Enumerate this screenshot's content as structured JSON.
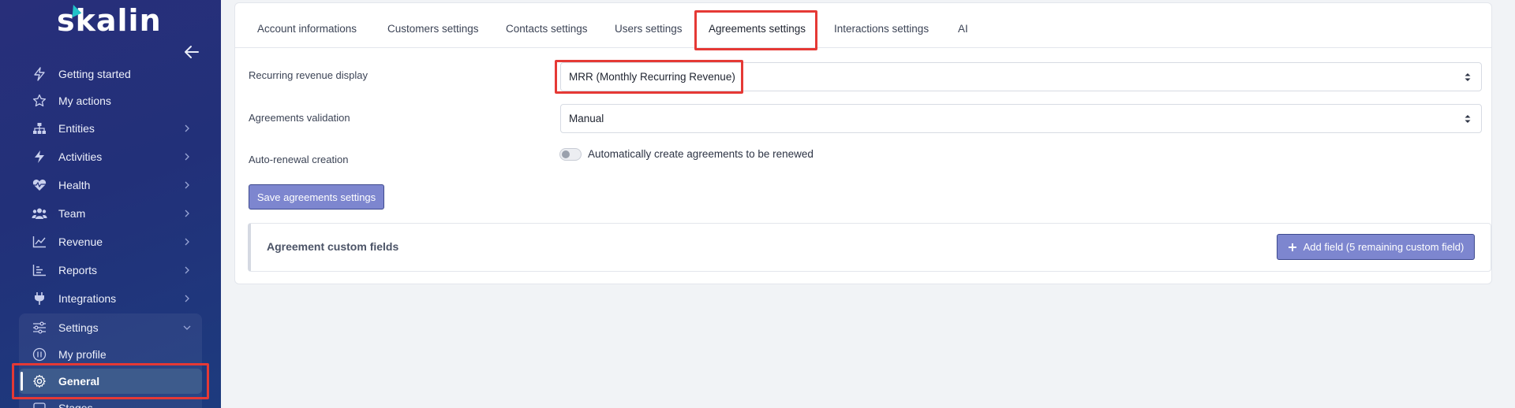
{
  "brand": {
    "logo_text": "skalin"
  },
  "sidebar": {
    "items": [
      {
        "label": "Getting started",
        "icon": "bolt-outline-icon"
      },
      {
        "label": "My actions",
        "icon": "star-icon"
      },
      {
        "label": "Entities",
        "icon": "sitemap-icon"
      },
      {
        "label": "Activities",
        "icon": "bolt-icon"
      },
      {
        "label": "Health",
        "icon": "heart-pulse-icon"
      },
      {
        "label": "Team",
        "icon": "users-icon"
      },
      {
        "label": "Revenue",
        "icon": "line-chart-icon"
      },
      {
        "label": "Reports",
        "icon": "bar-chart-icon"
      },
      {
        "label": "Integrations",
        "icon": "plug-icon"
      },
      {
        "label": "Settings",
        "icon": "sliders-icon"
      },
      {
        "label": "My profile",
        "icon": "user-circle-icon"
      },
      {
        "label": "General",
        "icon": "gear-icon"
      },
      {
        "label": "Stages",
        "icon": "stages-icon"
      }
    ]
  },
  "tabs": [
    {
      "label": "Account informations"
    },
    {
      "label": "Customers settings"
    },
    {
      "label": "Contacts settings"
    },
    {
      "label": "Users settings"
    },
    {
      "label": "Agreements settings"
    },
    {
      "label": "Interactions settings"
    },
    {
      "label": "AI"
    }
  ],
  "form": {
    "recurring_revenue_label": "Recurring revenue display",
    "recurring_revenue_value": "MRR (Monthly Recurring Revenue)",
    "validation_label": "Agreements validation",
    "validation_value": "Manual",
    "auto_renewal_label": "Auto-renewal creation",
    "auto_renewal_toggle_label": "Automatically create agreements to be renewed",
    "save_button": "Save agreements settings"
  },
  "custom_fields": {
    "title": "Agreement custom fields",
    "add_button": "Add field (5 remaining custom field)"
  },
  "colors": {
    "sidebar_bg": "#23307a",
    "accent": "#7d86cf",
    "highlight": "#e53935",
    "logo_accent": "#22c3c9"
  }
}
